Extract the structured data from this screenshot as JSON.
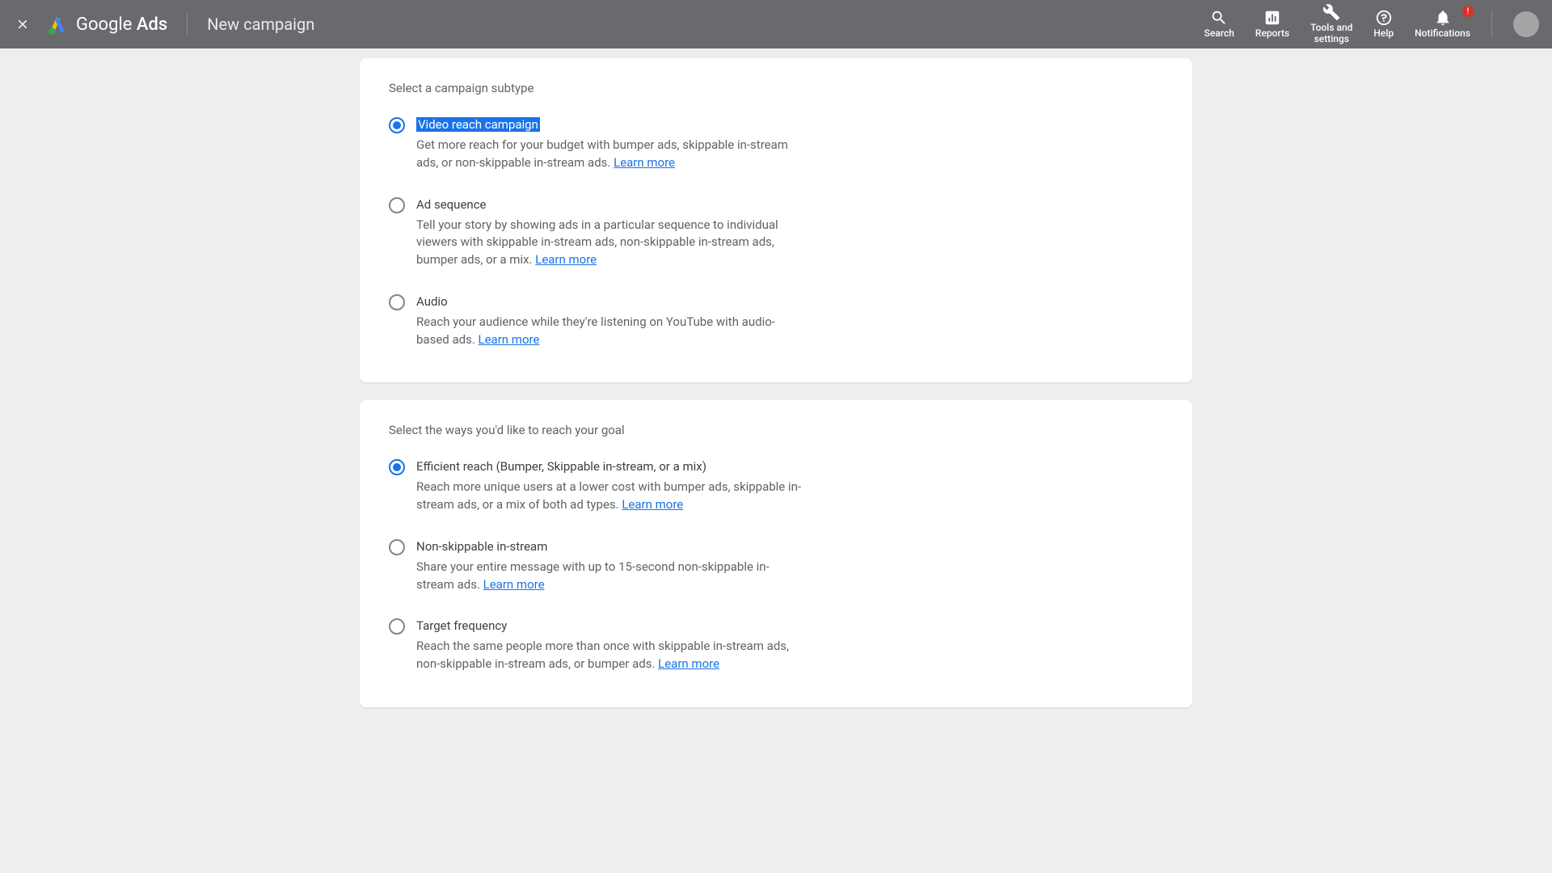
{
  "header": {
    "logo_word1": "Google",
    "logo_word2": "Ads",
    "page_title": "New campaign",
    "nav": {
      "search": "Search",
      "reports": "Reports",
      "tools": "Tools and\nsettings",
      "help": "Help",
      "notifications": "Notifications",
      "badge": "!"
    }
  },
  "card1": {
    "title": "Select a campaign subtype",
    "options": [
      {
        "title": "Video reach campaign",
        "desc": "Get more reach for your budget with bumper ads, skippable in-stream ads, or non-skippable in-stream ads.",
        "learn": "Learn more",
        "selected": true,
        "highlight": true
      },
      {
        "title": "Ad sequence",
        "desc": "Tell your story by showing ads in a particular sequence to individual viewers with skippable in-stream ads, non-skippable in-stream ads, bumper ads, or a mix.",
        "learn": "Learn more",
        "selected": false
      },
      {
        "title": "Audio",
        "desc": "Reach your audience while they're listening on YouTube with audio-based ads.",
        "learn": "Learn more",
        "selected": false
      }
    ]
  },
  "card2": {
    "title": "Select the ways you'd like to reach your goal",
    "options": [
      {
        "title": "Efficient reach (Bumper, Skippable in-stream, or a mix)",
        "desc": "Reach more unique users at a lower cost with bumper ads, skippable in-stream ads, or a mix of both ad types.",
        "learn": "Learn more",
        "selected": true
      },
      {
        "title": "Non-skippable in-stream",
        "desc": "Share your entire message with up to 15-second non-skippable in-stream ads.",
        "learn": "Learn more",
        "selected": false
      },
      {
        "title": "Target frequency",
        "desc": "Reach the same people more than once with skippable in-stream ads, non-skippable in-stream ads, or bumper ads.",
        "learn": "Learn more",
        "selected": false
      }
    ]
  }
}
